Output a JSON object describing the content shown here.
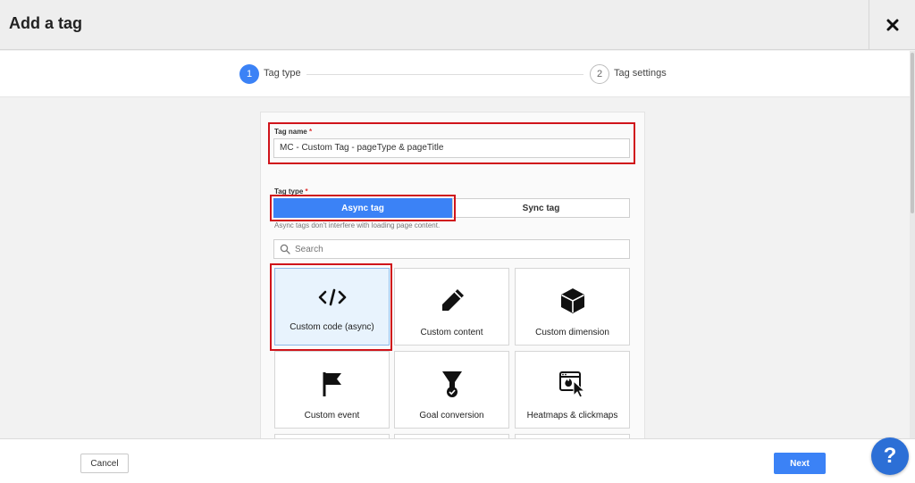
{
  "dialog": {
    "title": "Add a tag",
    "close_icon": "close-icon"
  },
  "stepper": {
    "steps": [
      {
        "number": "1",
        "label": "Tag type",
        "active": true
      },
      {
        "number": "2",
        "label": "Tag settings",
        "active": false
      }
    ]
  },
  "form": {
    "tag_name": {
      "label": "Tag name",
      "required_mark": "*",
      "value": "MC - Custom Tag - pageType & pageTitle"
    },
    "tag_type": {
      "label": "Tag type",
      "required_mark": "*",
      "options": [
        {
          "label": "Async tag",
          "selected": true
        },
        {
          "label": "Sync tag",
          "selected": false
        }
      ],
      "hint": "Async tags don't interfere with loading page content."
    },
    "search": {
      "placeholder": "Search",
      "icon": "search-icon"
    },
    "tiles": [
      {
        "label": "Custom code (async)",
        "icon": "code-icon",
        "selected": true
      },
      {
        "label": "Custom content",
        "icon": "pencil-icon",
        "selected": false
      },
      {
        "label": "Custom dimension",
        "icon": "cube-icon",
        "selected": false
      },
      {
        "label": "Custom event",
        "icon": "flag-icon",
        "selected": false
      },
      {
        "label": "Goal conversion",
        "icon": "funnel-check-icon",
        "selected": false
      },
      {
        "label": "Heatmaps & clickmaps",
        "icon": "heatmap-cursor-icon",
        "selected": false
      }
    ]
  },
  "footer": {
    "cancel_label": "Cancel",
    "next_label": "Next",
    "help_label": "?"
  },
  "colors": {
    "accent": "#3b82f6",
    "highlight": "#d0141b",
    "help_button": "#2c6fd6"
  }
}
